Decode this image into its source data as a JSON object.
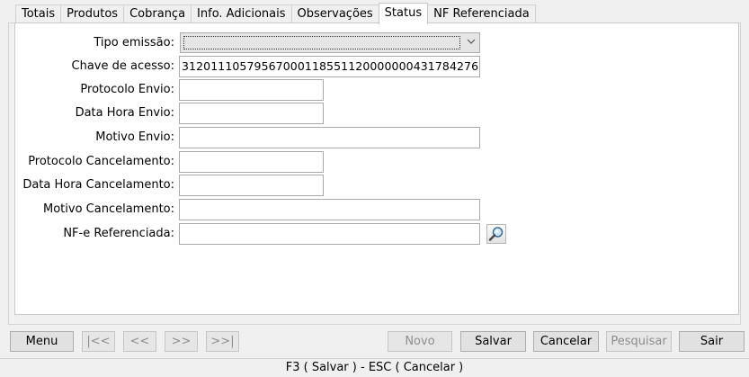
{
  "tabs": [
    "Totais",
    "Produtos",
    "Cobrança",
    "Info. Adicionais",
    "Observações",
    "Status",
    "NF Referenciada"
  ],
  "active_tab": "Status",
  "form": {
    "tipo_emissao_label": "Tipo emissão:",
    "tipo_emissao_value": "",
    "chave_acesso_label": "Chave de acesso:",
    "chave_acesso_value": "31201110579567000118551120000000431784276",
    "protocolo_envio_label": "Protocolo Envio:",
    "protocolo_envio_value": "",
    "data_hora_envio_label": "Data Hora Envio:",
    "data_hora_envio_value": "",
    "motivo_envio_label": "Motivo Envio:",
    "motivo_envio_value": "",
    "protocolo_cancelamento_label": "Protocolo Cancelamento:",
    "protocolo_cancelamento_value": "",
    "data_hora_cancelamento_label": "Data Hora Cancelamento:",
    "data_hora_cancelamento_value": "",
    "motivo_cancelamento_label": "Motivo Cancelamento:",
    "motivo_cancelamento_value": "",
    "nfe_referenciada_label": "NF-e Referenciada:",
    "nfe_referenciada_value": "",
    "search_icon": "magnifier-icon"
  },
  "buttons": {
    "menu": "Menu",
    "first": "|<<",
    "prev": "<<",
    "next": ">>",
    "last": ">>|",
    "novo": "Novo",
    "salvar": "Salvar",
    "cancelar": "Cancelar",
    "pesquisar": "Pesquisar",
    "sair": "Sair"
  },
  "status_bar": "F3 ( Salvar )  -  ESC ( Cancelar )"
}
